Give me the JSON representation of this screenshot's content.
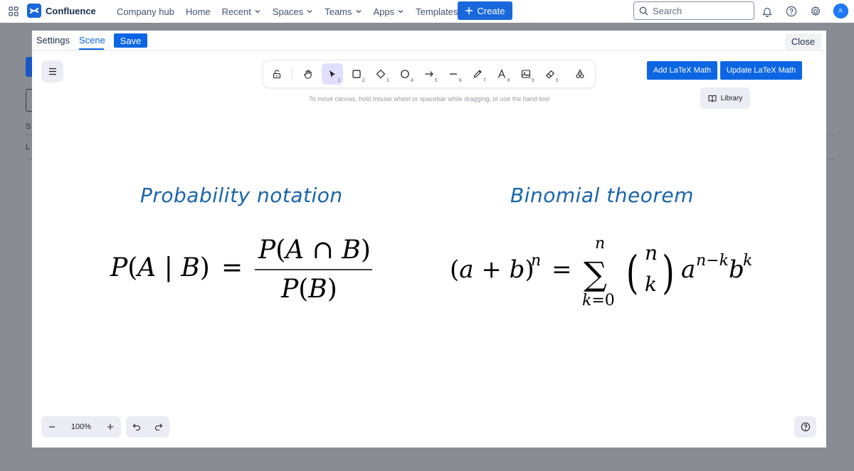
{
  "app": {
    "name": "Confluence",
    "accent": "#1868db"
  },
  "nav": {
    "items": [
      {
        "label": "Company hub",
        "dropdown": false
      },
      {
        "label": "Home",
        "dropdown": false
      },
      {
        "label": "Recent",
        "dropdown": true
      },
      {
        "label": "Spaces",
        "dropdown": true
      },
      {
        "label": "Teams",
        "dropdown": true
      },
      {
        "label": "Apps",
        "dropdown": true
      },
      {
        "label": "Templates",
        "dropdown": false
      }
    ],
    "create_label": "Create",
    "search_placeholder": "Search",
    "avatar_initials": "JL"
  },
  "background_page": {
    "label_s": "S",
    "label_l": "L"
  },
  "modal": {
    "tabs": [
      "Settings",
      "Scene"
    ],
    "active_tab": "Scene",
    "save_label": "Save",
    "close_label": "Close"
  },
  "canvas": {
    "toolbar": {
      "tools": [
        {
          "name": "lock",
          "num": ""
        },
        {
          "name": "hand",
          "num": ""
        },
        {
          "name": "selection",
          "num": "1",
          "selected": true
        },
        {
          "name": "rectangle",
          "num": "2"
        },
        {
          "name": "diamond",
          "num": "3"
        },
        {
          "name": "ellipse",
          "num": "4"
        },
        {
          "name": "arrow",
          "num": "5"
        },
        {
          "name": "line",
          "num": "6"
        },
        {
          "name": "draw",
          "num": "7"
        },
        {
          "name": "text",
          "num": "8"
        },
        {
          "name": "image",
          "num": "9"
        },
        {
          "name": "eraser",
          "num": "0"
        },
        {
          "name": "more-tools",
          "num": ""
        }
      ]
    },
    "hint": "To move canvas, hold mouse wheel or spacebar while dragging, or use the hand tool",
    "add_latex_label": "Add LaTeX Math",
    "update_latex_label": "Update LaTeX Math",
    "library_label": "Library",
    "zoom_value": "100%",
    "left_title": "Probability notation",
    "right_title": "Binomial theorem",
    "title_color": "#1864ab"
  }
}
